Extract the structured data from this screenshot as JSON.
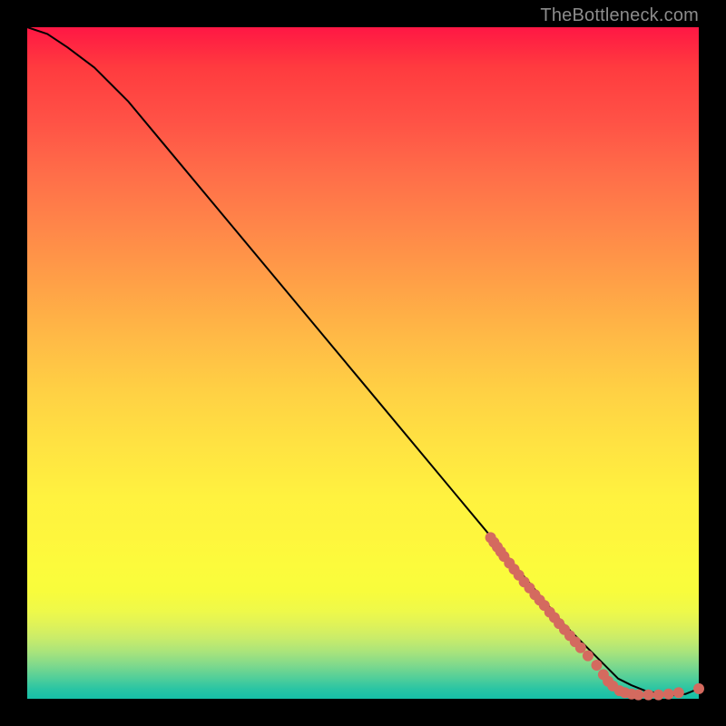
{
  "watermark": "TheBottleneck.com",
  "chart_data": {
    "type": "line",
    "title": "",
    "xlabel": "",
    "ylabel": "",
    "xlim": [
      0,
      100
    ],
    "ylim": [
      0,
      100
    ],
    "grid": false,
    "legend": false,
    "series": [
      {
        "name": "curve",
        "color": "#000000",
        "x": [
          0,
          3,
          6,
          10,
          15,
          20,
          30,
          40,
          50,
          60,
          70,
          75,
          80,
          85,
          88,
          90,
          92,
          94,
          96,
          98,
          100
        ],
        "values": [
          100,
          99,
          97,
          94,
          89,
          83,
          71,
          59,
          47,
          35,
          23,
          17,
          11,
          6,
          3,
          2,
          1.2,
          0.8,
          0.5,
          0.7,
          1.5
        ]
      }
    ],
    "markers": [
      {
        "name": "dots",
        "color": "#d46a5f",
        "radius": 6,
        "points": [
          {
            "x": 69.0,
            "y": 24.0
          },
          {
            "x": 69.5,
            "y": 23.3
          },
          {
            "x": 70.0,
            "y": 22.6
          },
          {
            "x": 70.5,
            "y": 21.9
          },
          {
            "x": 71.0,
            "y": 21.2
          },
          {
            "x": 71.8,
            "y": 20.2
          },
          {
            "x": 72.5,
            "y": 19.3
          },
          {
            "x": 73.2,
            "y": 18.4
          },
          {
            "x": 74.0,
            "y": 17.4
          },
          {
            "x": 74.8,
            "y": 16.5
          },
          {
            "x": 75.6,
            "y": 15.5
          },
          {
            "x": 76.3,
            "y": 14.7
          },
          {
            "x": 77.0,
            "y": 13.9
          },
          {
            "x": 77.8,
            "y": 12.9
          },
          {
            "x": 78.5,
            "y": 12.1
          },
          {
            "x": 79.2,
            "y": 11.2
          },
          {
            "x": 80.0,
            "y": 10.3
          },
          {
            "x": 80.8,
            "y": 9.4
          },
          {
            "x": 81.6,
            "y": 8.5
          },
          {
            "x": 82.4,
            "y": 7.6
          },
          {
            "x": 83.5,
            "y": 6.4
          },
          {
            "x": 84.8,
            "y": 5.0
          },
          {
            "x": 85.8,
            "y": 3.6
          },
          {
            "x": 86.5,
            "y": 2.6
          },
          {
            "x": 87.2,
            "y": 1.9
          },
          {
            "x": 88.2,
            "y": 1.2
          },
          {
            "x": 89.0,
            "y": 0.9
          },
          {
            "x": 90.0,
            "y": 0.7
          },
          {
            "x": 91.0,
            "y": 0.6
          },
          {
            "x": 92.5,
            "y": 0.6
          },
          {
            "x": 94.0,
            "y": 0.6
          },
          {
            "x": 95.5,
            "y": 0.7
          },
          {
            "x": 97.0,
            "y": 0.9
          },
          {
            "x": 100.0,
            "y": 1.5
          }
        ]
      }
    ]
  }
}
